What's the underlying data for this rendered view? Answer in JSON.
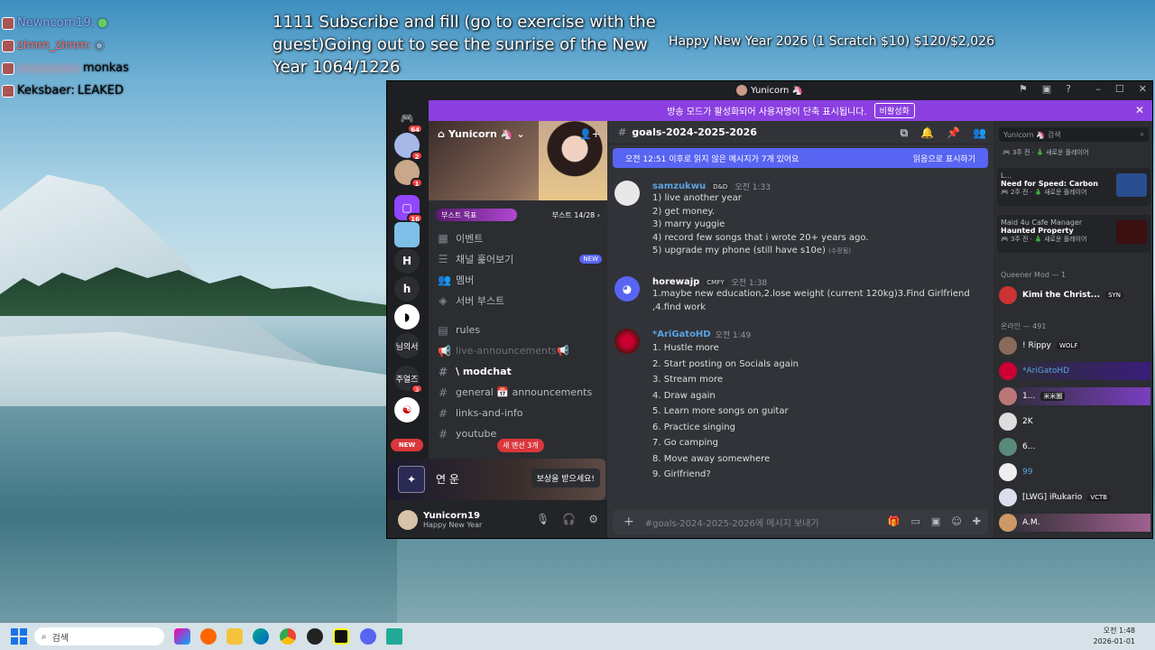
{
  "stream_overlay": {
    "chat": [
      {
        "user": "Newncorn19:",
        "msg": "",
        "color": "#8fa6ff"
      },
      {
        "user": "zimm_zimm:",
        "msg": "",
        "color": "#ff6b6b"
      },
      {
        "user": "",
        "msg": "monkas",
        "color": "#f0a0a0"
      },
      {
        "user": "Keksbaer:",
        "msg": "LEAKED",
        "color": "#ffffff"
      }
    ],
    "subgoal": "1111 Subscribe and fill (go to exercise with the guest)Going out to see the sunrise of the New Year 1064/1226",
    "newyear_goal": "Happy New Year 2026 (1 Scratch $10) $120/$2,026"
  },
  "window": {
    "title": "Yunicorn 🦄",
    "banner_text": "방송 모드가 활성화되어 사용자명이 단축 표시됩니다.",
    "banner_button": "비활성화"
  },
  "servers": [
    {
      "label": "",
      "badge": "64",
      "color": "#5865f2",
      "icon": "discord-icon"
    },
    {
      "label": "",
      "badge": "2",
      "color": "#a5b8e8",
      "icon": "server-avatar"
    },
    {
      "label": "",
      "badge": "1",
      "color": "#c9a88a",
      "icon": "server-avatar"
    },
    {
      "label": "",
      "badge": "16",
      "color": "#9146ff",
      "icon": "twitch-icon"
    },
    {
      "label": "",
      "badge": "",
      "color": "#7fc0e8",
      "icon": "server-avatar"
    },
    {
      "label": "H",
      "badge": "",
      "color": "#2b2d31",
      "icon": ""
    },
    {
      "label": "h",
      "badge": "",
      "color": "#2b2d31",
      "icon": ""
    },
    {
      "label": "",
      "badge": "",
      "color": "#ffffff",
      "icon": "server-avatar"
    },
    {
      "label": "님의서",
      "badge": "",
      "color": "#2b2d31",
      "icon": ""
    },
    {
      "label": "주얼즈",
      "badge": "3",
      "color": "#2b2d31",
      "icon": ""
    },
    {
      "label": "",
      "badge": "",
      "color": "#ffffff",
      "icon": "korea-flag-icon"
    },
    {
      "label": "NEW",
      "badge": "",
      "color": "#da373c",
      "icon": ""
    }
  ],
  "channel_sidebar": {
    "server_name": "Yunicorn 🦄",
    "boost_goal_label": "부스트 목표",
    "boost_count": "부스트 14/28 ›",
    "nav_items": [
      {
        "label": "이벤트",
        "icon": "calendar-icon",
        "badge": ""
      },
      {
        "label": "채널 훑어보기",
        "icon": "browse-icon",
        "badge": "NEW"
      },
      {
        "label": "멤버",
        "icon": "members-icon",
        "badge": ""
      },
      {
        "label": "서버 부스트",
        "icon": "boost-icon",
        "badge": ""
      }
    ],
    "channels": [
      {
        "label": "rules",
        "icon": "rules-icon",
        "active": false
      },
      {
        "label": "live-announcements📢",
        "icon": "announce-icon",
        "active": false
      },
      {
        "label": "\\ modchat",
        "icon": "hash-icon",
        "active": true
      },
      {
        "label": "general 📅 announcements",
        "icon": "hash-icon",
        "active": false
      },
      {
        "label": "links-and-info",
        "icon": "hash-icon",
        "active": false
      },
      {
        "label": "youtube",
        "icon": "hash-icon",
        "active": false
      }
    ],
    "new_mentions": "새 멘션 3개",
    "reward_title": "연 운",
    "reward_button": "보상을 받으세요!"
  },
  "user_panel": {
    "name": "Yunicorn19",
    "status": "Happy New Year"
  },
  "chat": {
    "channel_name": "goals-2024-2025-2026",
    "unread_text": "오전 12:51 이후로 읽지 않은 메시지가 7개 있어요",
    "mark_read": "읽음으로 표시하기",
    "input_placeholder": "#goals-2024-2025-2026에 메시지 보내기",
    "messages": [
      {
        "author": "samzukwu",
        "tag": "D&D",
        "time": "오전 1:33",
        "color": "#5ba3e0",
        "lines": [
          "1) live another year",
          "2) get money.",
          "3) marry yuggie",
          "4) record few songs that i wrote 20+ years ago.",
          "5) upgrade my phone (still have s10e)"
        ],
        "edited": "(수정됨)"
      },
      {
        "author": "horewajp",
        "tag": "CMFY",
        "time": "오전 1:38",
        "color": "#ffffff",
        "lines": [
          "1.maybe new education,2.lose weight (current 120kg)3.Find Girlfriend ,4.find work"
        ],
        "edited": ""
      },
      {
        "author": "*AriGatoHD",
        "tag": "",
        "time": "오전 1:49",
        "color": "#5ba3e0",
        "lines": [
          "1. Hustle more",
          "2. Start posting on Socials again",
          "3. Stream more",
          "4. Draw again",
          "5. Learn more songs on guitar",
          "6. Practice singing",
          "7. Go camping",
          "8. Move away somewhere",
          "9. Girlfriend?"
        ],
        "edited": ""
      }
    ]
  },
  "members_panel": {
    "search_placeholder": "Yunicorn 🦄 검색",
    "top_activity": "🎮 3주 전 · 🎄 새로운 플레이어",
    "activities": [
      {
        "user": "L...",
        "game": "Need for Speed: Carbon",
        "sub": "🎮 2주 전 · 🎄 새로운 플레이어",
        "art": "#2a4d8f"
      },
      {
        "user": "Maid 4u Cafe Manager",
        "game": "Haunted Property",
        "sub": "🎮 3주 전 · 🎄 새로운 플레이어",
        "art": "#3a1010"
      }
    ],
    "mod_header": "Queener Mod — 1",
    "mod_member": {
      "name": "Kimi the Christ...",
      "tag": "SYN"
    },
    "online_header": "온라인 — 491",
    "online": [
      {
        "name": "! Rippy",
        "tag": "WOLF",
        "color": "#ffffff"
      },
      {
        "name": "*AriGatoHD",
        "tag": "",
        "color": "#5ba3e0"
      },
      {
        "name": "1...",
        "tag": "米米圖",
        "color": "#ffffff"
      },
      {
        "name": "2K",
        "tag": "",
        "color": "#ffffff"
      },
      {
        "name": "6...",
        "tag": "",
        "color": "#ffffff"
      },
      {
        "name": "99",
        "tag": "",
        "color": "#5ba3e0"
      },
      {
        "name": "[LWG] iRukario",
        "tag": "VCTB",
        "color": "#ffffff"
      },
      {
        "name": "A.M.",
        "tag": "",
        "color": "#ffffff"
      }
    ]
  },
  "taskbar": {
    "search_placeholder": "검색",
    "time": "오전 1:48",
    "date": "2026-01-01"
  }
}
